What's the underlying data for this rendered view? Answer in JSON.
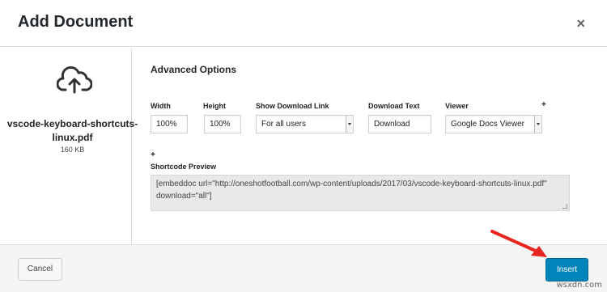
{
  "dialog": {
    "title": "Add Document",
    "close_glyph": "×"
  },
  "file": {
    "icon": "cloud-upload-icon",
    "name": "vscode-keyboard-shortcuts-linux.pdf",
    "size": "160 KB"
  },
  "options": {
    "section_title": "Advanced Options",
    "width_label": "Width",
    "width_value": "100%",
    "height_label": "Height",
    "height_value": "100%",
    "download_link_label": "Show Download Link",
    "download_link_value": "For all users",
    "download_text_label": "Download Text",
    "download_text_value": "Download",
    "viewer_label": "Viewer",
    "viewer_value": "Google Docs Viewer",
    "plus_glyph": "+"
  },
  "shortcode": {
    "label": "Shortcode Preview",
    "value": "[embeddoc url=\"http://oneshotfootball.com/wp-content/uploads/2017/03/vscode-keyboard-shortcuts-linux.pdf\" download=\"all\"]"
  },
  "footer": {
    "cancel_label": "Cancel",
    "insert_label": "Insert"
  },
  "colors": {
    "primary_button": "#0085ba",
    "annotation_arrow": "#e8251e"
  },
  "watermark": "wsxdn.com"
}
